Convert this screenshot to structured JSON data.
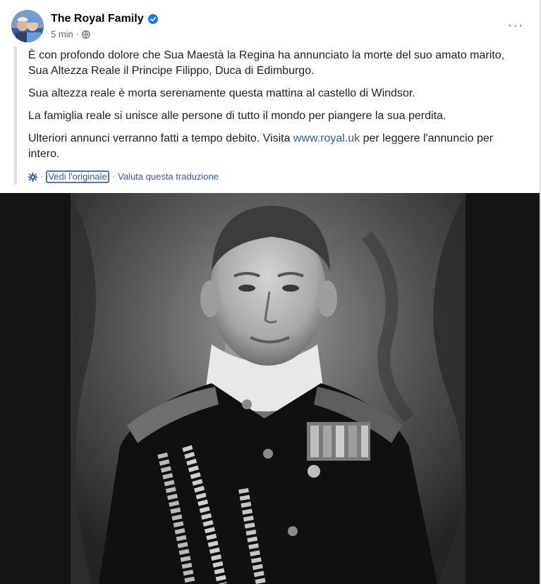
{
  "post": {
    "author": "The Royal Family",
    "time": "5 min",
    "more_label": "···",
    "paragraphs": [
      "È con profondo dolore che Sua Maestà la Regina ha annunciato la morte del suo amato marito, Sua Altezza Reale il Principe Filippo, Duca di Edimburgo.",
      "Sua altezza reale è morta serenamente questa mattina al castello di Windsor.",
      "La famiglia reale si unisce alle persone di tutto il mondo per piangere la sua perdita."
    ],
    "last_paragraph_prefix": "Ulteriori annunci verranno fatti a tempo debito. Visita ",
    "link": "www.royal.uk",
    "last_paragraph_suffix": " per leggere l'annuncio per intero.",
    "see_original": "Vedi l'originale",
    "separator": "·",
    "rate_translation": "Valuta questa traduzione"
  },
  "colors": {
    "link": "#385898",
    "verified": "#1877f2",
    "photo_background": "#141414"
  },
  "icons": {
    "verified": "verified-badge-icon",
    "audience": "globe-icon",
    "more": "more-options-icon",
    "translation": "gear-icon"
  }
}
